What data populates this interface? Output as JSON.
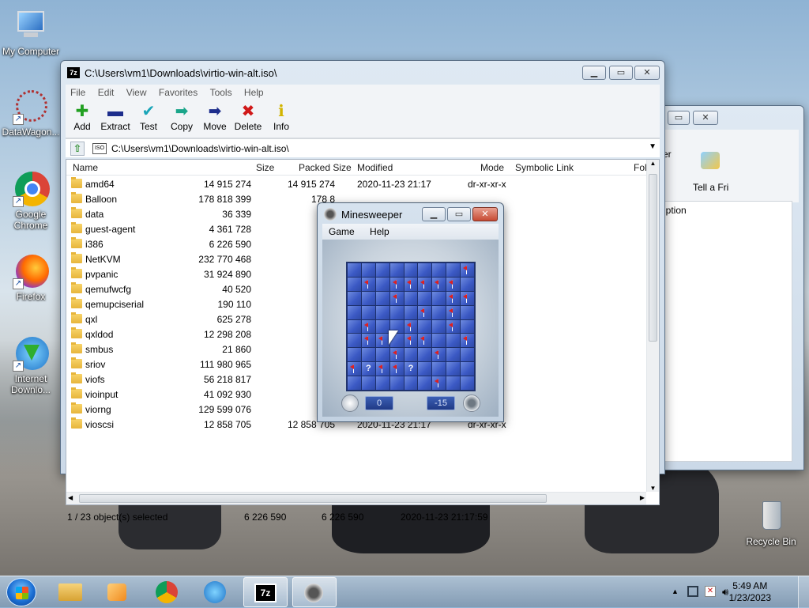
{
  "desktop": {
    "icons": [
      {
        "label": "My Computer"
      },
      {
        "label": "DataWagon..."
      },
      {
        "label": "Google Chrome"
      },
      {
        "label": "Firefox"
      },
      {
        "label": "Internet Downlo..."
      },
      {
        "label": "Recycle Bin"
      }
    ]
  },
  "zip_window": {
    "title": "C:\\Users\\vm1\\Downloads\\virtio-win-alt.iso\\",
    "title_icon": "7z",
    "menu": [
      "File",
      "Edit",
      "View",
      "Favorites",
      "Tools",
      "Help"
    ],
    "toolbar": [
      {
        "label": "Add",
        "icon": "add-icon",
        "color": "#22a022"
      },
      {
        "label": "Extract",
        "icon": "extract-icon",
        "color": "#1d2d8c"
      },
      {
        "label": "Test",
        "icon": "test-icon",
        "color": "#1aa5b8"
      },
      {
        "label": "Copy",
        "icon": "copy-icon",
        "color": "#1aa58a"
      },
      {
        "label": "Move",
        "icon": "move-icon",
        "color": "#1d2d8c"
      },
      {
        "label": "Delete",
        "icon": "delete-icon",
        "color": "#d01818"
      },
      {
        "label": "Info",
        "icon": "info-icon",
        "color": "#d2b400"
      }
    ],
    "address": "C:\\Users\\vm1\\Downloads\\virtio-win-alt.iso\\",
    "address_icon_text": "ISO",
    "columns": [
      "Name",
      "Size",
      "Packed Size",
      "Modified",
      "Mode",
      "Symbolic Link",
      "Fol"
    ],
    "rows": [
      {
        "name": "amd64",
        "size": "14 915 274",
        "packed": "14 915 274",
        "modified": "2020-11-23 21:17",
        "mode": "dr-xr-xr-x"
      },
      {
        "name": "Balloon",
        "size": "178 818 399",
        "packed": "178 8",
        "modified": "",
        "mode": ""
      },
      {
        "name": "data",
        "size": "36 339",
        "packed": "",
        "modified": "",
        "mode": ""
      },
      {
        "name": "guest-agent",
        "size": "4 361 728",
        "packed": "4",
        "modified": "",
        "mode": ""
      },
      {
        "name": "i386",
        "size": "6 226 590",
        "packed": "6",
        "modified": "",
        "mode": ""
      },
      {
        "name": "NetKVM",
        "size": "232 770 468",
        "packed": "232",
        "modified": "",
        "mode": ""
      },
      {
        "name": "pvpanic",
        "size": "31 924 890",
        "packed": "31 9",
        "modified": "",
        "mode": ""
      },
      {
        "name": "qemufwcfg",
        "size": "40 520",
        "packed": "",
        "modified": "",
        "mode": ""
      },
      {
        "name": "qemupciserial",
        "size": "190 110",
        "packed": "",
        "modified": "",
        "mode": ""
      },
      {
        "name": "qxl",
        "size": "625 278",
        "packed": "",
        "modified": "",
        "mode": ""
      },
      {
        "name": "qxldod",
        "size": "12 298 208",
        "packed": "12",
        "modified": "",
        "mode": ""
      },
      {
        "name": "smbus",
        "size": "21 860",
        "packed": "",
        "modified": "",
        "mode": ""
      },
      {
        "name": "sriov",
        "size": "111 980 965",
        "packed": "111",
        "modified": "",
        "mode": ""
      },
      {
        "name": "viofs",
        "size": "56 218 817",
        "packed": "56",
        "modified": "",
        "mode": ""
      },
      {
        "name": "vioinput",
        "size": "41 092 930",
        "packed": "41",
        "modified": "",
        "mode": ""
      },
      {
        "name": "viorng",
        "size": "129 599 076",
        "packed": "129",
        "modified": "",
        "mode": ""
      },
      {
        "name": "vioscsi",
        "size": "12 858 705",
        "packed": "12 858 705",
        "modified": "2020-11-23 21:17",
        "mode": "dr-xr-xr-x"
      }
    ],
    "status": {
      "selection": "1 / 23 object(s) selected",
      "size": "6 226 590",
      "packed": "6 226 590",
      "modified": "2020-11-23 21:17:59"
    }
  },
  "minesweeper": {
    "title": "Minesweeper",
    "menu": [
      "Game",
      "Help"
    ],
    "timer": "0",
    "mines_left": "-15",
    "grid": [
      [
        ".",
        ".",
        ".",
        ".",
        ".",
        ".",
        ".",
        ".",
        "F"
      ],
      [
        ".",
        "F",
        ".",
        "F",
        "F",
        "F",
        "F",
        "F",
        "."
      ],
      [
        ".",
        ".",
        ".",
        "F",
        ".",
        ".",
        ".",
        "F",
        "F"
      ],
      [
        ".",
        ".",
        ".",
        ".",
        ".",
        "F",
        ".",
        "F",
        "."
      ],
      [
        ".",
        "F",
        ".",
        ".",
        "F",
        ".",
        ".",
        "F",
        "."
      ],
      [
        ".",
        "F",
        "F",
        ".",
        "F",
        "F",
        ".",
        ".",
        "F"
      ],
      [
        ".",
        ".",
        ".",
        "F",
        ".",
        ".",
        "F",
        ".",
        "."
      ],
      [
        "F",
        "?",
        "F",
        "F",
        "?",
        ".",
        ".",
        ".",
        "."
      ],
      [
        ".",
        ".",
        ".",
        ".",
        ".",
        ".",
        "F",
        ".",
        "."
      ]
    ]
  },
  "background_window": {
    "toolbar_label": "Tell a Fri",
    "partial_label": "er",
    "column_fragment": "iption"
  },
  "taskbar": {
    "apps": [
      "file-explorer",
      "media-player",
      "chrome",
      "internet-download-manager",
      "7zip",
      "minesweeper"
    ],
    "clock_time": "5:49 AM",
    "clock_date": "1/23/2023"
  }
}
